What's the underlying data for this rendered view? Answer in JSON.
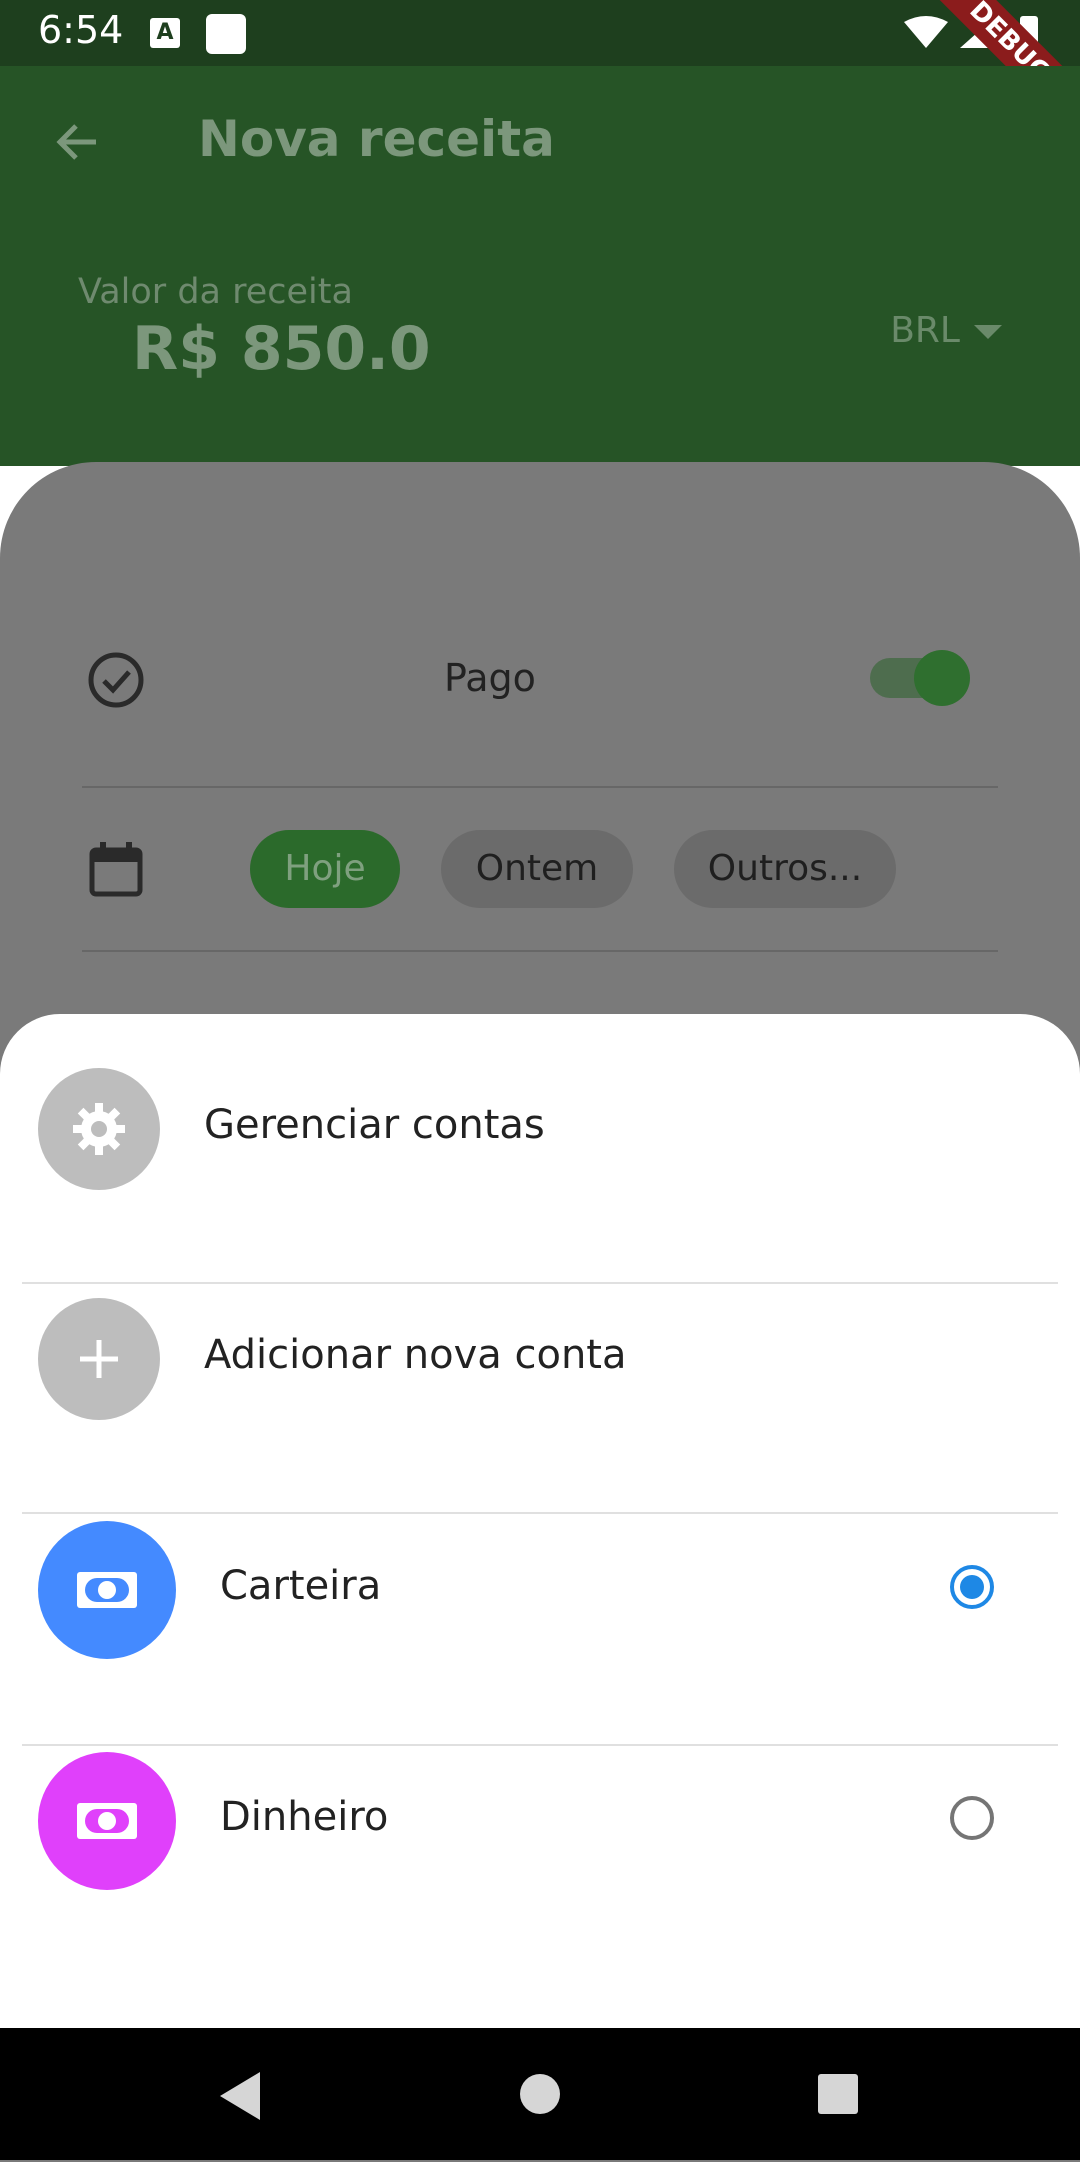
{
  "status_bar": {
    "time": "6:54",
    "debug": "DEBUG",
    "notification_icon": "A"
  },
  "app_bar": {
    "title": "Nova receita"
  },
  "amount": {
    "label": "Valor da receita",
    "value": "R$ 850.0",
    "currency": "BRL"
  },
  "form": {
    "paid": {
      "label": "Pago",
      "checked": true
    },
    "date_chips": [
      {
        "label": "Hoje",
        "selected": true
      },
      {
        "label": "Ontem",
        "selected": false
      },
      {
        "label": "Outros...",
        "selected": false
      }
    ]
  },
  "sheet": {
    "manage": {
      "label": "Gerenciar contas",
      "icon": "gear-icon"
    },
    "add": {
      "label": "Adicionar nova conta",
      "icon": "plus-icon"
    },
    "accounts": [
      {
        "label": "Carteira",
        "color": "#448aff",
        "icon": "money-icon",
        "selected": true
      },
      {
        "label": "Dinheiro",
        "color": "#e040fb",
        "icon": "money-icon",
        "selected": false
      }
    ]
  },
  "colors": {
    "primary": "#265426",
    "accent": "#1e88e5"
  }
}
